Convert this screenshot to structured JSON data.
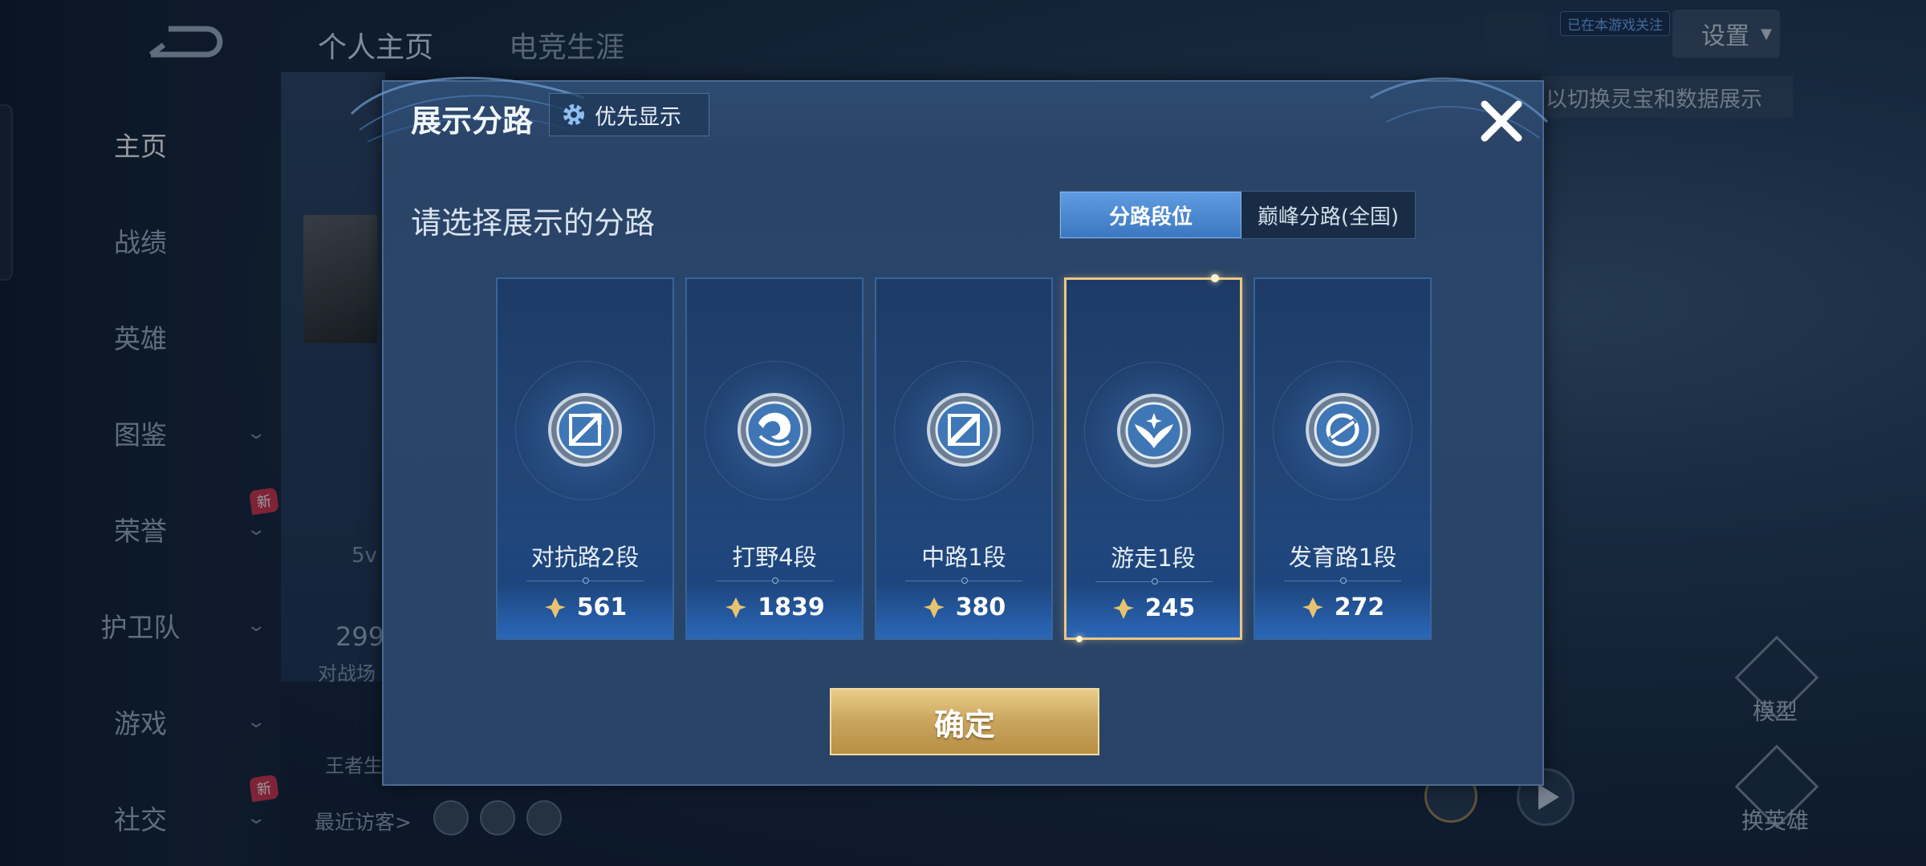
{
  "sidebar": {
    "items": [
      {
        "label": "主页",
        "active": true,
        "chevron": false,
        "badge": ""
      },
      {
        "label": "战绩",
        "active": false,
        "chevron": false,
        "badge": ""
      },
      {
        "label": "英雄",
        "active": false,
        "chevron": false,
        "badge": ""
      },
      {
        "label": "图鉴",
        "active": false,
        "chevron": true,
        "badge": ""
      },
      {
        "label": "荣誉",
        "active": false,
        "chevron": true,
        "badge": "新"
      },
      {
        "label": "护卫队",
        "active": false,
        "chevron": true,
        "badge": ""
      },
      {
        "label": "游戏",
        "active": false,
        "chevron": true,
        "badge": ""
      },
      {
        "label": "社交",
        "active": false,
        "chevron": true,
        "badge": "新"
      }
    ]
  },
  "top_tabs": [
    {
      "label": "个人主页",
      "active": true
    },
    {
      "label": "电竞生涯",
      "active": false
    }
  ],
  "background": {
    "number_partial": "299",
    "label_partial": "对战场",
    "label2_partial": "王者生",
    "level_partial": "5v",
    "recent_visitors": "最近访客>"
  },
  "top_right": {
    "tag": "已在本游戏关注",
    "settings_label": "设置",
    "hint": "以切换灵宝和数据展示",
    "model_label": "模型",
    "change_hero_label": "换英雄"
  },
  "modal": {
    "title": "展示分路",
    "priority_label": "优先显示",
    "subtitle": "请选择展示的分路",
    "toggle": [
      {
        "label": "分路段位",
        "active": true
      },
      {
        "label": "巅峰分路(全国)",
        "active": false
      }
    ],
    "lanes": [
      {
        "name": "对抗路2段",
        "score": "561",
        "icon": "sword-shield-icon",
        "selected": false
      },
      {
        "name": "打野4段",
        "score": "1839",
        "icon": "dragon-claw-icon",
        "selected": false
      },
      {
        "name": "中路1段",
        "score": "380",
        "icon": "mid-slash-icon",
        "selected": false
      },
      {
        "name": "游走1段",
        "score": "245",
        "icon": "wings-icon",
        "selected": true
      },
      {
        "name": "发育路1段",
        "score": "272",
        "icon": "arrow-circle-icon",
        "selected": false
      }
    ],
    "confirm_label": "确定"
  },
  "colors": {
    "modal_bg": "#29456a",
    "accent_blue": "#3c78c0",
    "selected_border": "#ebc785",
    "confirm_gold": "#c9a55d"
  }
}
